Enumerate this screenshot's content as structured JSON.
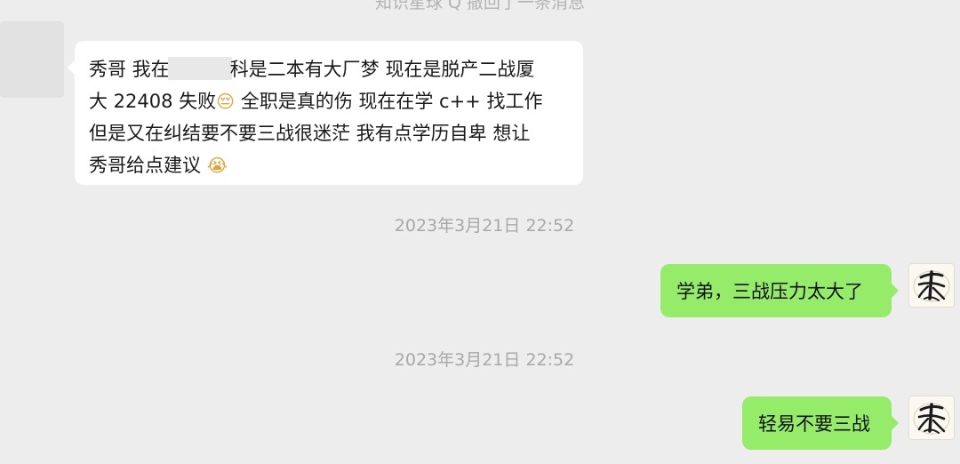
{
  "chat": {
    "system_notice": "知识星球 Q 撤回了一条消息",
    "incoming": {
      "line1_before": "秀哥 我在",
      "line1_after": "科是二本有大厂梦 现在是脱产二战厦",
      "line2_text": "大 22408 失败",
      "emoji1": "😔",
      "line2_after": "  全职是真的伤 现在在学 c++ 找工作",
      "line3": "但是又在纠结要不要三战很迷茫 我有点学历自卑  想让",
      "line4_text": "秀哥给点建议",
      "emoji2": "😭"
    },
    "messages": [
      {
        "timestamp": "2023年3月21日 22:52",
        "text": "学弟，三战压力太大了"
      },
      {
        "timestamp": "2023年3月21日 22:52",
        "text": "轻易不要三战"
      }
    ],
    "colors": {
      "background": "#ededed",
      "bubble_incoming": "#ffffff",
      "bubble_outgoing": "#95ec69"
    },
    "avatar_icon": "calligraphy-avatar-icon"
  }
}
